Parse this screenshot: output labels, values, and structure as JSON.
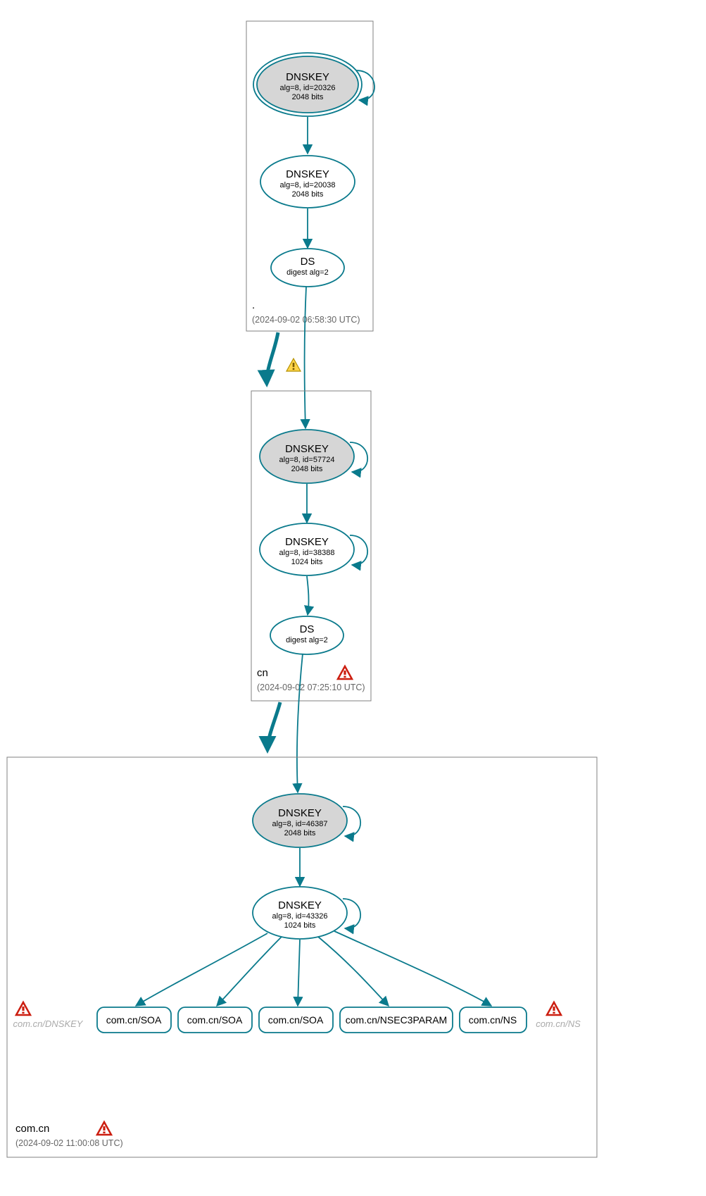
{
  "colors": {
    "teal": "#0a7a8c",
    "nodeFill": "#d6d6d6",
    "border": "#808080",
    "warnYellow": "#ffd54a",
    "warnYellowStroke": "#b59100",
    "errRed": "#cc1e10",
    "errRedStroke": "#8a0b00"
  },
  "zones": [
    {
      "name": ".",
      "timestamp": "(2024-09-02 06:58:30 UTC)"
    },
    {
      "name": "cn",
      "timestamp": "(2024-09-02 07:25:10 UTC)"
    },
    {
      "name": "com.cn",
      "timestamp": "(2024-09-02 11:00:08 UTC)"
    }
  ],
  "nodes": {
    "root_ksk": {
      "title": "DNSKEY",
      "line2": "alg=8, id=20326",
      "line3": "2048 bits"
    },
    "root_zsk": {
      "title": "DNSKEY",
      "line2": "alg=8, id=20038",
      "line3": "2048 bits"
    },
    "root_ds": {
      "title": "DS",
      "line2": "digest alg=2",
      "line3": ""
    },
    "cn_ksk": {
      "title": "DNSKEY",
      "line2": "alg=8, id=57724",
      "line3": "2048 bits"
    },
    "cn_zsk": {
      "title": "DNSKEY",
      "line2": "alg=8, id=38388",
      "line3": "1024 bits"
    },
    "cn_ds": {
      "title": "DS",
      "line2": "digest alg=2",
      "line3": ""
    },
    "comcn_ksk": {
      "title": "DNSKEY",
      "line2": "alg=8, id=46387",
      "line3": "2048 bits"
    },
    "comcn_zsk": {
      "title": "DNSKEY",
      "line2": "alg=8, id=43326",
      "line3": "1024 bits"
    }
  },
  "leaves": {
    "dnskey_grey": "com.cn/DNSKEY",
    "soa1": "com.cn/SOA",
    "soa2": "com.cn/SOA",
    "soa3": "com.cn/SOA",
    "nsec3": "com.cn/NSEC3PARAM",
    "ns": "com.cn/NS",
    "ns_grey": "com.cn/NS"
  }
}
